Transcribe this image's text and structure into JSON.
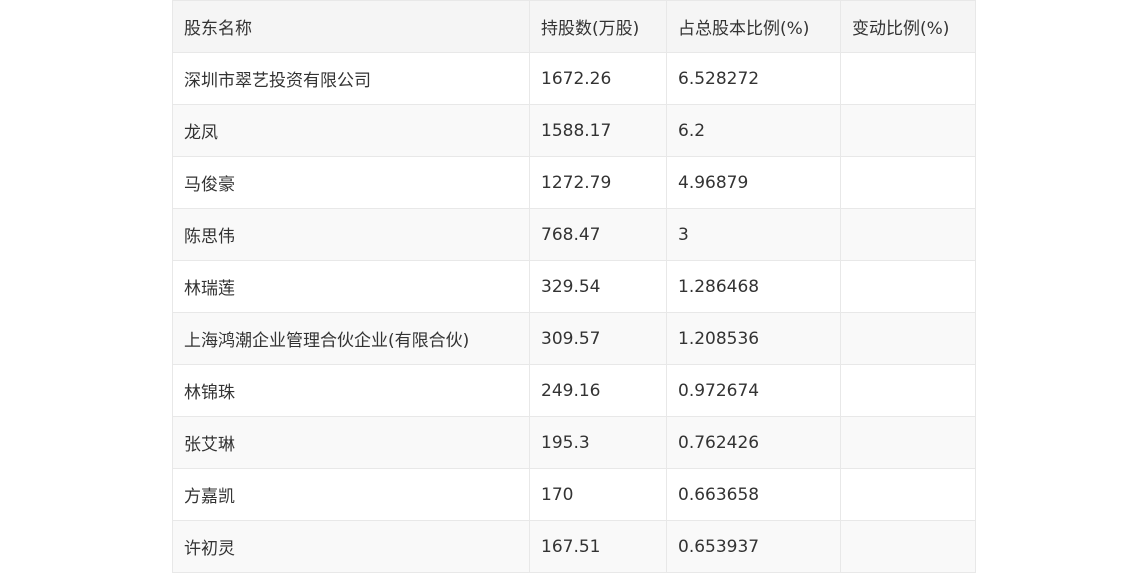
{
  "table": {
    "headers": [
      "股东名称",
      "持股数(万股)",
      "占总股本比例(%)",
      "变动比例(%)"
    ],
    "rows": [
      [
        "深圳市翠艺投资有限公司",
        "1672.26",
        "6.528272",
        ""
      ],
      [
        "龙凤",
        "1588.17",
        "6.2",
        ""
      ],
      [
        "马俊豪",
        "1272.79",
        "4.96879",
        ""
      ],
      [
        "陈思伟",
        "768.47",
        "3",
        ""
      ],
      [
        "林瑞莲",
        "329.54",
        "1.286468",
        ""
      ],
      [
        "上海鸿潮企业管理合伙企业(有限合伙)",
        "309.57",
        "1.208536",
        ""
      ],
      [
        "林锦珠",
        "249.16",
        "0.972674",
        ""
      ],
      [
        "张艾琳",
        "195.3",
        "0.762426",
        ""
      ],
      [
        "方嘉凯",
        "170",
        "0.663658",
        ""
      ],
      [
        "许初灵",
        "167.51",
        "0.653937",
        ""
      ]
    ]
  }
}
